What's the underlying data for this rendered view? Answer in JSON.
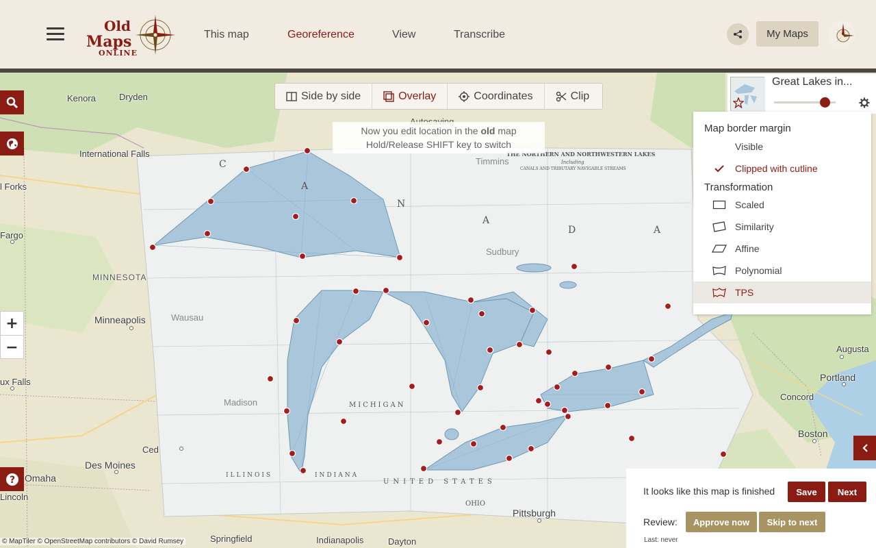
{
  "header": {
    "logo": {
      "line1": "Old",
      "line2": "Maps",
      "line3": "Online"
    },
    "nav": [
      "This map",
      "Georeference",
      "View",
      "Transcribe"
    ],
    "active_nav": "Georeference",
    "my_maps_label": "My Maps"
  },
  "toolbar": {
    "side_by_side": "Side by side",
    "overlay": "Overlay",
    "coordinates": "Coordinates",
    "clip": "Clip"
  },
  "status": {
    "autosaving": "Autosaving",
    "notice_line1_pre": "Now you edit location in the ",
    "notice_line1_bold": "old",
    "notice_line1_post": " map",
    "notice_line2": "Hold/Release SHIFT key to switch"
  },
  "map_card": {
    "title": "Great Lakes in..."
  },
  "dropdown": {
    "border_heading": "Map border margin",
    "border_options": [
      "Visible",
      "Clipped with cutline"
    ],
    "border_selected": "Clipped with cutline",
    "transform_heading": "Transformation",
    "transform_options": [
      "Scaled",
      "Similarity",
      "Affine",
      "Polynomial",
      "TPS"
    ],
    "transform_selected": "TPS"
  },
  "finish_panel": {
    "message": "It looks like this map is finished",
    "save": "Save",
    "next": "Next",
    "review_label": "Review:",
    "approve": "Approve now",
    "skip": "Skip to next",
    "last": "Last: never"
  },
  "places": [
    "Kenora",
    "Dryden",
    "International Falls",
    "l Forks",
    "Fargo",
    "MINNESOTA",
    "Minneapolis",
    "ux Falls",
    "Ced",
    "Des Moines",
    "Omaha",
    "Lincoln",
    "Springfield",
    "Indianapolis",
    "Dayton",
    "Pittsburgh",
    "Augusta",
    "Portland",
    "Concord",
    "Boston",
    "Timmins",
    "Sudbury",
    "Wausau",
    "Madison"
  ],
  "old_map": {
    "title_line1": "THE NORTHERN AND NORTHWESTERN LAKES",
    "title_line2": "Including",
    "title_line3": "CANALS AND TRIBUTARY NAVIGABLE STREAMS"
  },
  "attribution": "© MapTiler © OpenStreetMap contributors © David Rumsey",
  "colors": {
    "accent": "#8a1c14",
    "tan": "#a89362",
    "water": "#a9c6db"
  }
}
